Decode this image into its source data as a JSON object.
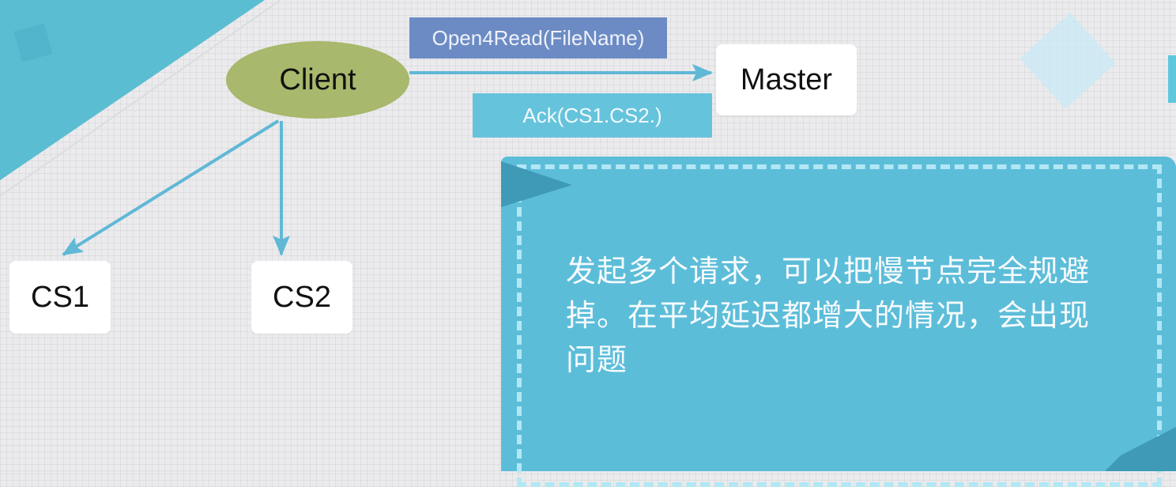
{
  "diagram": {
    "client": "Client",
    "master": "Master",
    "cs1": "CS1",
    "cs2": "CS2",
    "request_label": "Open4Read(FileName)",
    "ack_label": "Ack(CS1.CS2.)",
    "note": "发起多个请求，可以把慢节点完全规避掉。在平均延迟都增大的情况，会出现问题"
  },
  "colors": {
    "client_fill": "#a8b86c",
    "arrow": "#5fb8d6",
    "request_label_bg": "#6c8bc4",
    "ack_label_bg": "#66c3dc",
    "note_bg": "#5cbdd9"
  }
}
